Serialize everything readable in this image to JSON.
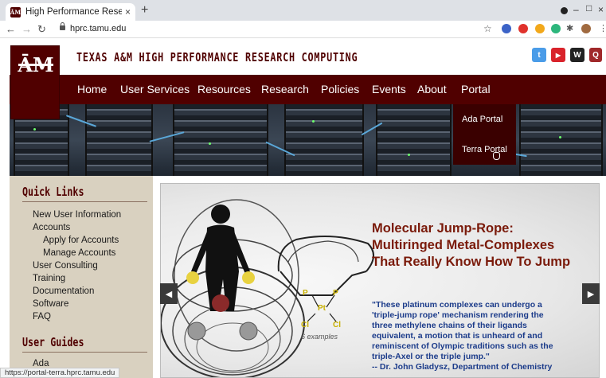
{
  "browser": {
    "tab_title": "High Performance Resear",
    "tab_close": "×",
    "new_tab": "+",
    "url": "hprc.tamu.edu",
    "status_url": "https://portal-terra.hprc.tamu.edu"
  },
  "site": {
    "logo_text": "ĀM",
    "title": "TEXAS A&M HIGH PERFORMANCE RESEARCH COMPUTING",
    "social": [
      {
        "icon": "twitter-icon",
        "glyph": "t",
        "color": "#4a9ce8"
      },
      {
        "icon": "youtube-icon",
        "glyph": "▶",
        "color": "#d9232b"
      },
      {
        "icon": "wiki-icon",
        "glyph": "W",
        "color": "#222222"
      },
      {
        "icon": "search-icon",
        "glyph": "Q",
        "color": "#a0282a"
      }
    ]
  },
  "nav": {
    "items": [
      "Home",
      "User Services",
      "Resources",
      "Research",
      "Policies",
      "Events",
      "About",
      "Portal"
    ]
  },
  "portal_menu": {
    "items": [
      "Ada Portal",
      "Terra Portal"
    ]
  },
  "sidebar": {
    "quick_links_heading": "Quick Links",
    "quick_links": [
      "New User Information",
      "Accounts",
      "Apply for Accounts",
      "Manage Accounts",
      "User Consulting",
      "Training",
      "Documentation",
      "Software",
      "FAQ"
    ],
    "user_guides_heading": "User Guides",
    "user_guides": [
      "Ada"
    ]
  },
  "slide": {
    "title_lines": [
      "Molecular Jump-Rope:",
      "Multiringed Metal-Complexes",
      "That Really Know How To Jump"
    ],
    "quote_lines": [
      "\"These platinum complexes can undergo a",
      "'triple-jump rope' mechanism rendering the",
      "three methylene chains of their ligands",
      "equivalent, a motion that is unheard of and",
      "reminiscent of Olympic traditions such as the",
      "triple-Axel or the triple jump.\"",
      "-- Dr. John Gladysz, Department of Chemistry"
    ],
    "molecule_caption": "6 examples",
    "atoms": {
      "p": "P",
      "pt": "Pt",
      "cl": "Cl"
    },
    "prev": "◀",
    "next": "▶"
  },
  "colors": {
    "maroon": "#500000",
    "sidebar_bg": "#d9d1c0",
    "slide_title": "#7a1a0a",
    "slide_quote": "#1b3b8a"
  }
}
